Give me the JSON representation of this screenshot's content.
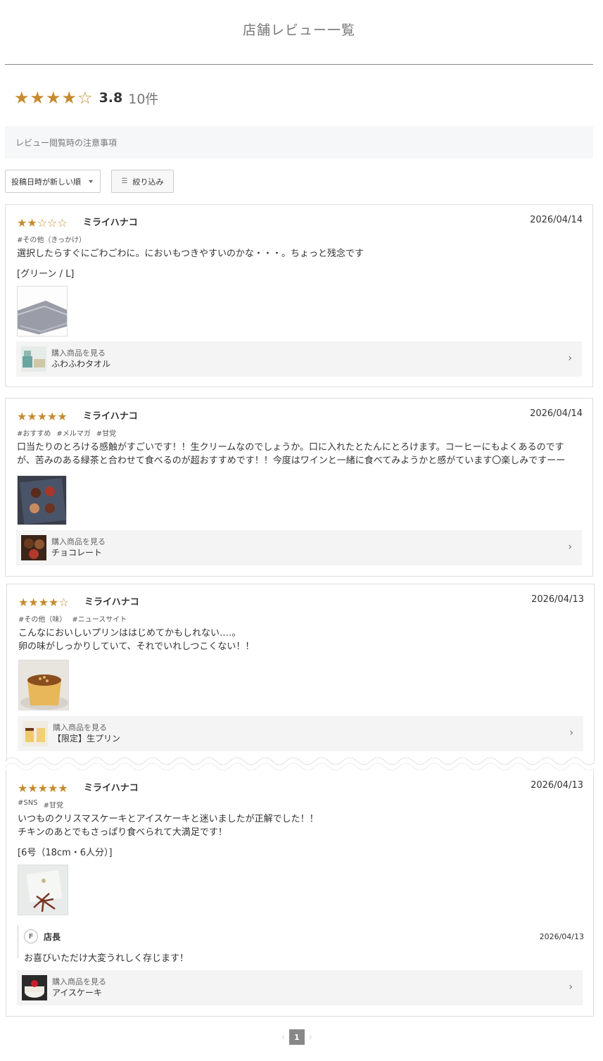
{
  "header": {
    "title": "店舗レビュー一覧"
  },
  "summary": {
    "stars": "★★★★☆",
    "score": "3.8",
    "count": "10件"
  },
  "notice": {
    "label": "レビュー閲覧時の注意事項"
  },
  "controls": {
    "sort_value": "投稿日時が新しい順",
    "filter_label": "絞り込み"
  },
  "reviews": [
    {
      "rating": 2,
      "stars_full": "★★",
      "stars_empty": "☆☆☆",
      "author": "ミライハナコ",
      "date": "2026/04/14",
      "tags": [
        "#その他（きっかけ）"
      ],
      "body": "選択したらすぐにごわごわに。においもつきやすいのかな・・・。ちょっと残念です",
      "variant": "[グリーン / L]",
      "product_label": "購入商品を見る",
      "product_name": "ふわふわタオル"
    },
    {
      "rating": 5,
      "stars_full": "★★★★★",
      "stars_empty": "",
      "author": "ミライハナコ",
      "date": "2026/04/14",
      "tags": [
        "#おすすめ",
        "#メルマガ",
        "#甘党"
      ],
      "body": "口当たりのとろける感触がすごいです！！生クリームなのでしょうか。口に入れたとたんにとろけます。コーヒーにもよくあるのですが、苦みのある緑茶と合わせて食べるのが超おすすめです！！今度はワインと一緒に食べてみようかと感がています〇楽しみですーー",
      "product_label": "購入商品を見る",
      "product_name": "チョコレート"
    },
    {
      "rating": 4,
      "stars_full": "★★★★",
      "stars_empty": "☆",
      "author": "ミライハナコ",
      "date": "2026/04/13",
      "tags": [
        "#その他（味）",
        "#ニュースサイト"
      ],
      "body_line1": "こんなにおいしいプリンははじめてかもしれない‥‥。",
      "body_line2": "卵の味がしっかりしていて、それでいれしつこくない！！",
      "product_label": "購入商品を見る",
      "product_name": "【限定】生プリン"
    },
    {
      "rating": 5,
      "stars_full": "★★★★★",
      "stars_empty": "",
      "author": "ミライハナコ",
      "date": "2026/04/13",
      "tags": [
        "#SNS",
        "#甘党"
      ],
      "body_line1": "いつものクリスマスケーキとアイスケーキと迷いましたが正解でした！！",
      "body_line2": "チキンのあとでもさっぱり食べられて大満足です！",
      "variant": "[6号（18cm・6人分）]",
      "reply": {
        "name": "店長",
        "date": "2026/04/13",
        "text": "お喜びいただけ大変うれしく存じます！"
      },
      "product_label": "購入商品を見る",
      "product_name": "アイスケーキ"
    }
  ],
  "pagination": {
    "current": "1",
    "prev": "‹",
    "next": "›"
  },
  "colors": {
    "star": "#c68b2f",
    "notice_bg": "#f6f7f8",
    "link_bg": "#f4f4f4"
  }
}
